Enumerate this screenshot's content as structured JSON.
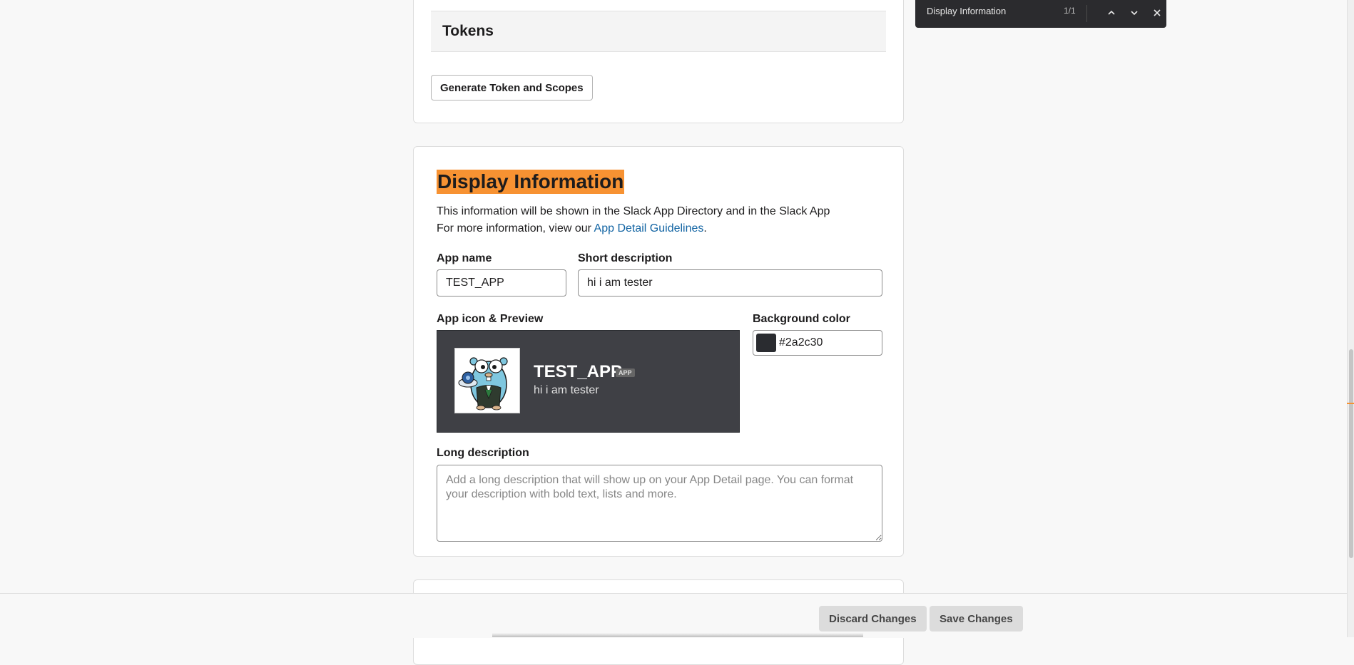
{
  "tokens_section": {
    "title": "Tokens",
    "generate_button": "Generate Token and Scopes"
  },
  "display_info": {
    "title": "Display Information",
    "description_line1": "This information will be shown in the Slack App Directory and in the Slack App",
    "description_line2_prefix": "For more information, view our ",
    "guidelines_link": "App Detail Guidelines",
    "description_line2_suffix": ".",
    "app_name_label": "App name",
    "app_name_value": "TEST_APP",
    "short_description_label": "Short description",
    "short_description_value": "hi i am tester",
    "app_icon_label": "App icon & Preview",
    "preview": {
      "name": "TEST_APP",
      "badge": "APP",
      "description": "hi i am tester"
    },
    "background_color_label": "Background color",
    "background_color_value": "#2a2c30",
    "long_description_label": "Long description",
    "long_description_placeholder": "Add a long description that will show up on your App Detail page. You can format your description with bold text, lists and more."
  },
  "bottom_bar": {
    "discard_label": "Discard Changes",
    "save_label": "Save Changes"
  },
  "find_bar": {
    "query": "Display Information",
    "count": "1/1"
  },
  "colors": {
    "highlight": "#f79232",
    "link": "#1264a3",
    "swatch": "#2a2c30"
  }
}
